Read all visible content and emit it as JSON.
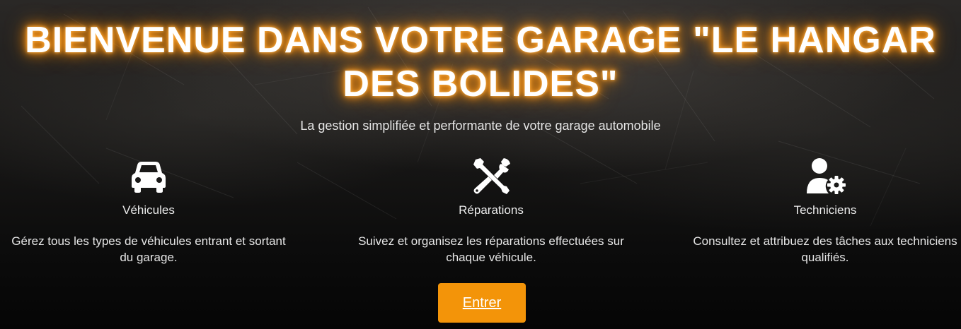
{
  "hero": {
    "title": "BIENVENUE DANS VOTRE GARAGE \"LE HANGAR DES BOLIDES\"",
    "subtitle": "La gestion simplifiée et performante de votre garage automobile"
  },
  "features": [
    {
      "icon": "car-icon",
      "title": "Véhicules",
      "description": "Gérez tous les types de véhicules entrant et sortant du garage."
    },
    {
      "icon": "tools-icon",
      "title": "Réparations",
      "description": "Suivez et organisez les réparations effectuées sur chaque véhicule."
    },
    {
      "icon": "user-gear-icon",
      "title": "Techniciens",
      "description": "Consultez et attribuez des tâches aux techniciens qualifiés."
    }
  ],
  "cta": {
    "label": "Entrer"
  },
  "colors": {
    "accent": "#f39409",
    "glow": "#ff8c00",
    "text": "#ffffff"
  }
}
